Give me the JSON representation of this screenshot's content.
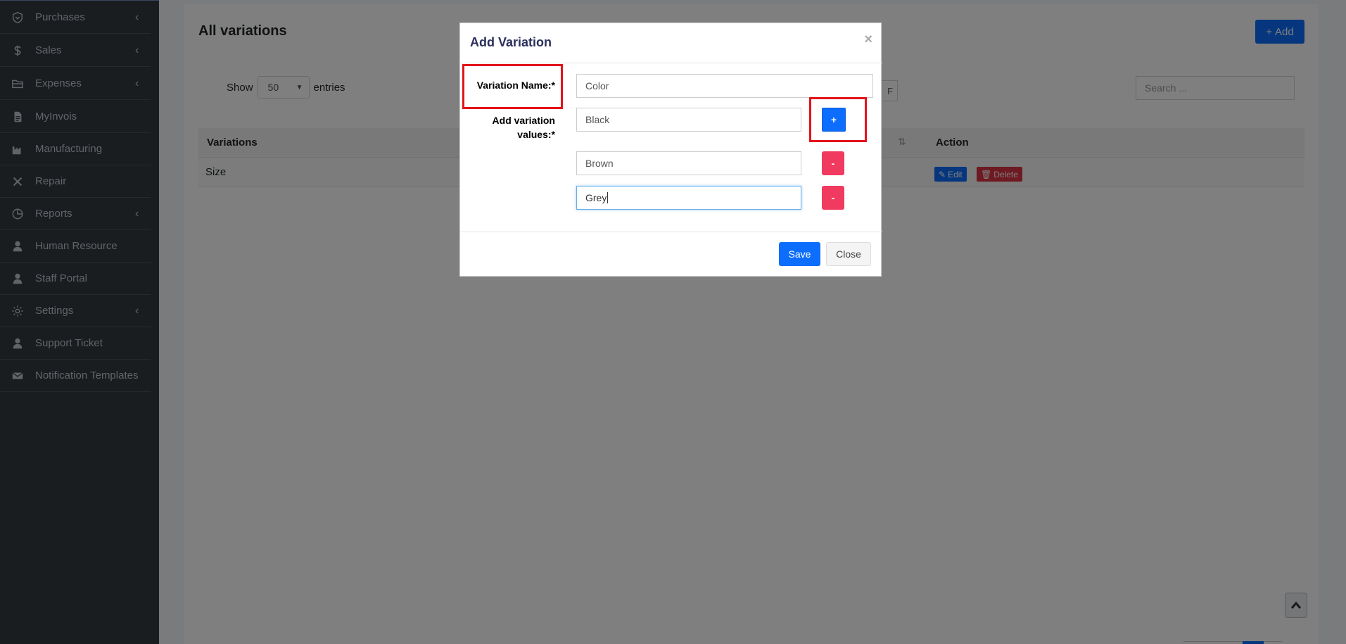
{
  "sidebar": {
    "items": [
      {
        "label": "Purchases",
        "icon": "shield-icon",
        "has_children": true
      },
      {
        "label": "Sales",
        "icon": "dollar-icon",
        "has_children": true
      },
      {
        "label": "Expenses",
        "icon": "folder-icon",
        "has_children": true
      },
      {
        "label": "MyInvois",
        "icon": "document-icon",
        "has_children": false
      },
      {
        "label": "Manufacturing",
        "icon": "industry-icon",
        "has_children": false
      },
      {
        "label": "Repair",
        "icon": "wrench-icon",
        "has_children": false
      },
      {
        "label": "Reports",
        "icon": "pie-chart-icon",
        "has_children": true
      },
      {
        "label": "Human Resource",
        "icon": "user-icon",
        "has_children": false
      },
      {
        "label": "Staff Portal",
        "icon": "user-icon",
        "has_children": false
      },
      {
        "label": "Settings",
        "icon": "gear-icon",
        "has_children": true
      },
      {
        "label": "Support Ticket",
        "icon": "user-icon",
        "has_children": false
      },
      {
        "label": "Notification Templates",
        "icon": "envelope-icon",
        "has_children": false
      }
    ],
    "chevron": "‹"
  },
  "page": {
    "title": "All variations",
    "add_button": "Add",
    "show_label": "Show",
    "entries_label": "entries",
    "entries_value": "50",
    "search_placeholder": "Search ...",
    "pdf_fragment": "F"
  },
  "table": {
    "columns": [
      "Variations",
      "Action"
    ],
    "rows": [
      {
        "variation": "Size"
      }
    ],
    "edit_label": "Edit",
    "delete_label": "Delete"
  },
  "modal": {
    "title": "Add Variation",
    "close_glyph": "×",
    "variation_name_label": "Variation Name:*",
    "variation_name_value": "Color",
    "values_label_line1": "Add variation",
    "values_label_line2": "values:*",
    "values": [
      "Black",
      "Brown",
      "Grey"
    ],
    "plus_label": "+",
    "minus_label": "-",
    "save_label": "Save",
    "close_label": "Close"
  },
  "colors": {
    "sidebar_bg": "#343a40",
    "primary": "#0d6efd",
    "danger": "#f03a5f",
    "annotation": "#e3131b"
  }
}
